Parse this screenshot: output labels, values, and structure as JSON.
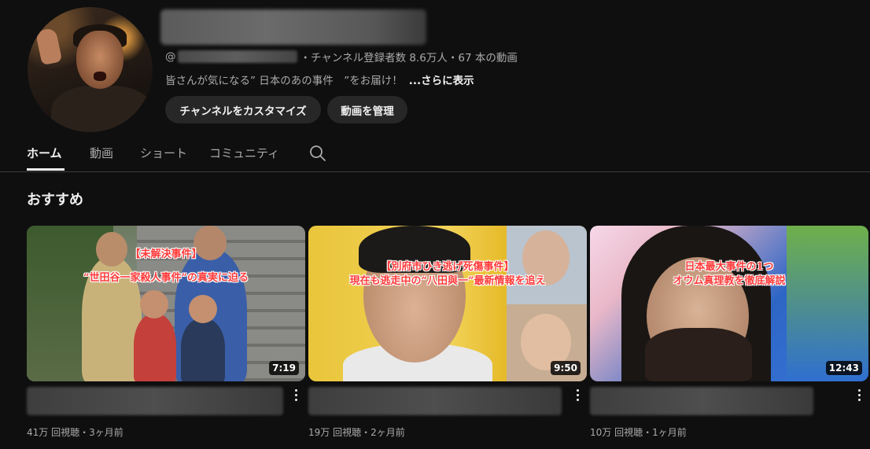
{
  "channel": {
    "handle_prefix": "@",
    "meta_text": "・チャンネル登録者数 8.6万人・67 本の動画",
    "description": "皆さんが気になる” 日本のあの事件　”をお届け！",
    "more_label": "...さらに表示"
  },
  "actions": {
    "customize_label": "チャンネルをカスタマイズ",
    "manage_label": "動画を管理"
  },
  "tabs": [
    {
      "label": "ホーム",
      "active": true
    },
    {
      "label": "動画",
      "active": false
    },
    {
      "label": "ショート",
      "active": false
    },
    {
      "label": "コミュニティ",
      "active": false
    }
  ],
  "search_icon": "search-icon",
  "section": {
    "title": "おすすめ"
  },
  "videos": [
    {
      "overlay_line1": "【未解決事件】",
      "overlay_line2": "“世田谷一家殺人事件”の真実に迫る",
      "duration": "7:19",
      "stats": "41万 回視聴・3ヶ月前"
    },
    {
      "overlay_line1": "【別府市ひき逃げ死傷事件】",
      "overlay_line2": "現在も逃走中の“八田與一”最新情報を追え",
      "duration": "9:50",
      "stats": "19万 回視聴・2ヶ月前"
    },
    {
      "overlay_line1": "日本最大事件の1つ",
      "overlay_line2": "オウム真理教を徹底解説",
      "duration": "12:43",
      "stats": "10万 回視聴・1ヶ月前"
    }
  ],
  "colors": {
    "background": "#0f0f0f",
    "button_bg": "#272727",
    "text_primary": "#f1f1f1",
    "text_secondary": "#aaaaaa",
    "overlay_red": "#ff3b3b"
  }
}
